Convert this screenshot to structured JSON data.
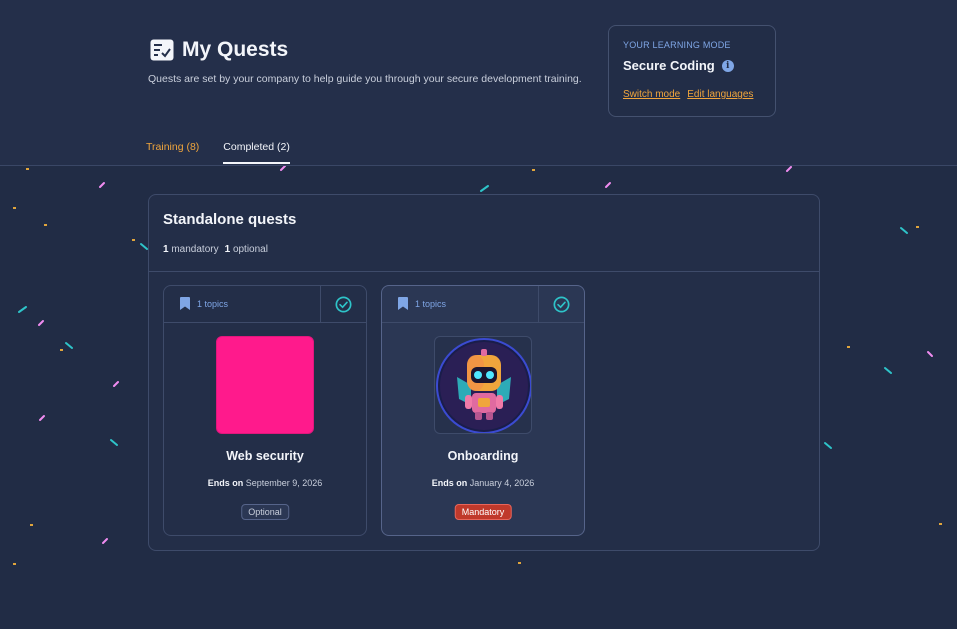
{
  "header": {
    "title": "My Quests",
    "title_icon": "checklist-icon",
    "subtitle": "Quests are set by your company to help guide you through your secure development training."
  },
  "learning_mode": {
    "label": "YOUR LEARNING MODE",
    "value": "Secure Coding",
    "info_icon": "info-icon",
    "switch_label": "Switch mode",
    "edit_label": "Edit languages"
  },
  "tabs": [
    {
      "label": "Training (8)",
      "active": false
    },
    {
      "label": "Completed (2)",
      "active": true
    }
  ],
  "panel": {
    "title": "Standalone quests",
    "mandatory_count": "1",
    "mandatory_label": "mandatory",
    "optional_count": "1",
    "optional_label": "optional"
  },
  "cards": [
    {
      "topics": "1 topics",
      "name": "Web security",
      "ends_label": "Ends on",
      "ends_date": "September 9, 2026",
      "badge": "Optional",
      "thumb": "pink-square",
      "completed": true
    },
    {
      "topics": "1 topics",
      "name": "Onboarding",
      "ends_label": "Ends on",
      "ends_date": "January 4, 2026",
      "badge": "Mandatory",
      "thumb": "robot-avatar",
      "completed": true
    }
  ],
  "colors": {
    "background": "#212c45",
    "accent_orange": "#f0a53c",
    "accent_blue": "#7fa6e6",
    "check_teal": "#2ec4c9",
    "mandatory_red": "#c0392b",
    "thumb_pink": "#ff1a8c"
  }
}
